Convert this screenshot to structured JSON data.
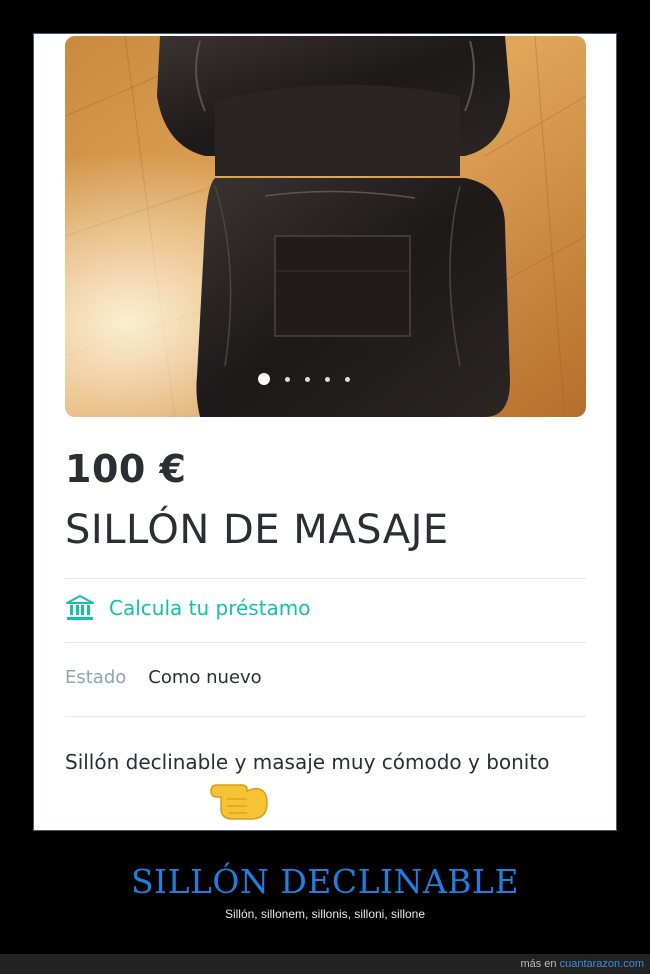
{
  "listing": {
    "price": "100 €",
    "title": "SILLÓN DE MASAJE",
    "loan_label": "Calcula tu préstamo",
    "estado_label": "Estado",
    "estado_value": "Como nuevo",
    "description": "Sillón declinable y masaje muy cómodo y bonito",
    "photo_count": 5,
    "active_photo": 1
  },
  "caption": {
    "title": "SILLÓN DECLINABLE",
    "subtitle": "Sillón, sillonem, sillonis, silloni, sillone"
  },
  "footer": {
    "prefix": "más en",
    "site": "cuantarazon.com"
  },
  "colors": {
    "accent": "#13c1ac",
    "caption_title": "#1f7ee0",
    "link": "#3d8fe0"
  },
  "icons": {
    "loan": "bank-icon",
    "hand": "pointing-hand-icon"
  }
}
